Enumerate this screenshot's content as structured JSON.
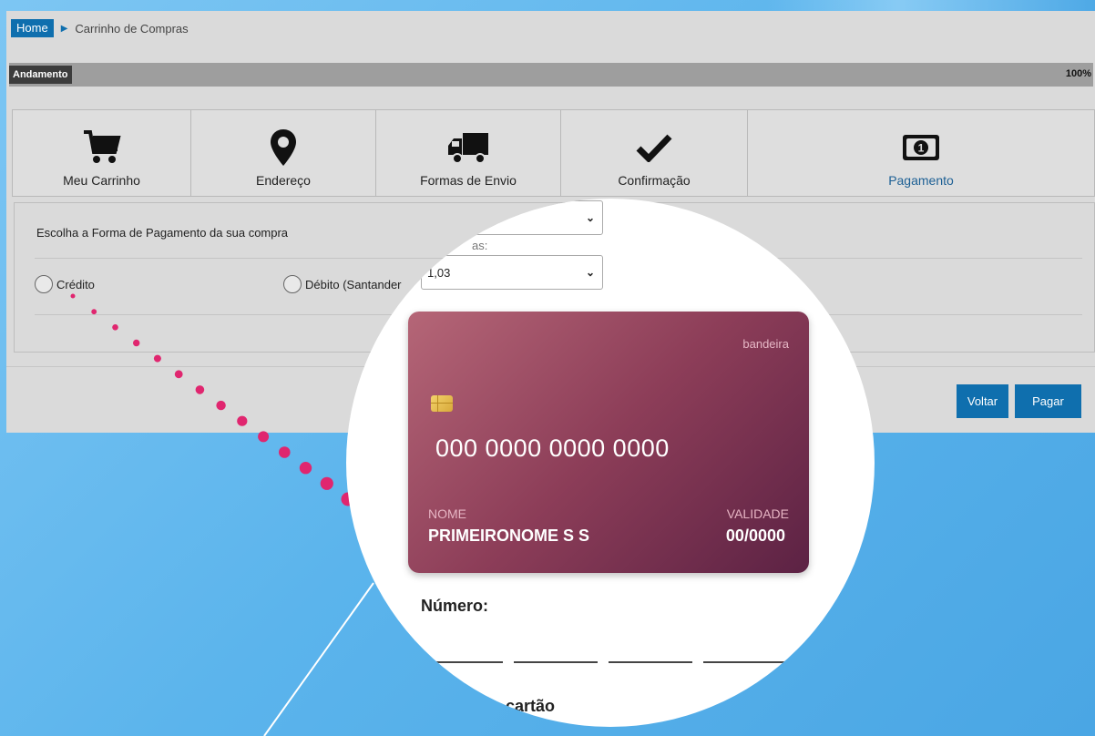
{
  "breadcrumb": {
    "home": "Home",
    "current": "Carrinho de Compras"
  },
  "progress": {
    "label": "Andamento",
    "value_text": "100%",
    "percent": 100
  },
  "steps": [
    {
      "label": "Meu Carrinho",
      "icon": "cart-icon"
    },
    {
      "label": "Endereço",
      "icon": "map-pin-icon"
    },
    {
      "label": "Formas de Envio",
      "icon": "truck-icon"
    },
    {
      "label": "Confirmação",
      "icon": "checkmark-icon"
    },
    {
      "label": "Pagamento",
      "icon": "money-icon",
      "active": true
    }
  ],
  "payment": {
    "title": "Escolha a Forma de Pagamento da sua compra",
    "options": [
      "Crédito",
      "Débito (Santander"
    ]
  },
  "buttons": {
    "back": "Voltar",
    "pay": "Pagar"
  },
  "magnifier": {
    "partial_caption": "as:",
    "installment_value": "1,03",
    "card": {
      "brand": "bandeira",
      "number": "000 0000 0000 0000",
      "name_label": "NOME",
      "name": "PRIMEIRONOME S S",
      "expiry_label": "VALIDADE",
      "expiry": "00/0000"
    },
    "number_field_label": "Número:",
    "name_on_card_partial": "no cartão"
  },
  "colors": {
    "accent": "#0f6fae",
    "background": "#5bb4ec",
    "dots": "#e0266f",
    "card_start": "#b56677",
    "card_end": "#5c2244"
  }
}
